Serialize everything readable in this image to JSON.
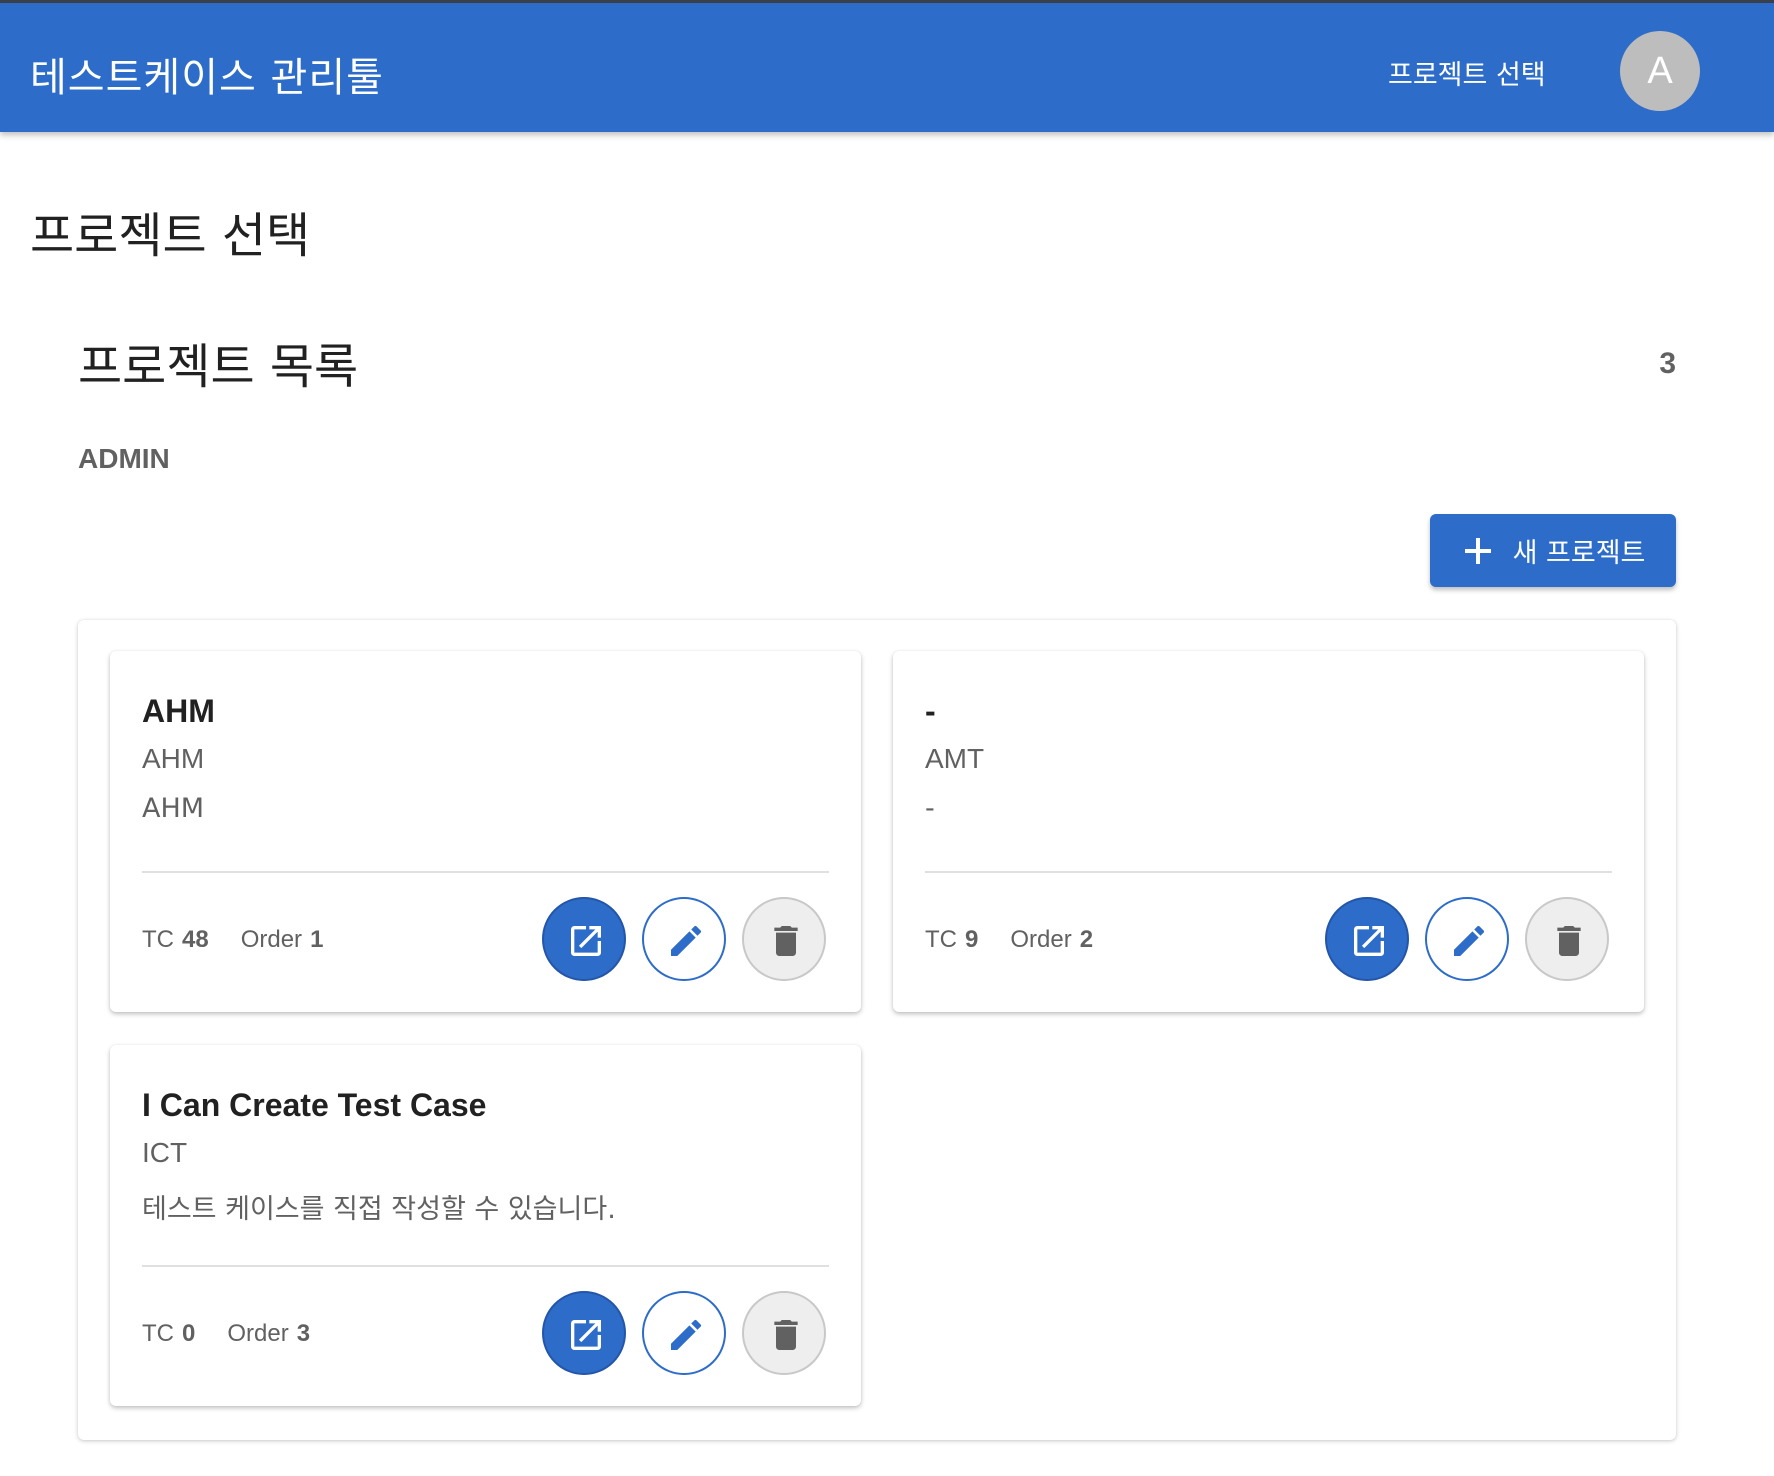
{
  "header": {
    "app_title": "테스트케이스 관리툴",
    "nav_project_select": "프로젝트 선택",
    "avatar_initial": "A"
  },
  "page": {
    "title": "프로젝트 선택"
  },
  "projects_section": {
    "title": "프로젝트 목록",
    "count": "3",
    "role": "ADMIN",
    "new_button_label": "새 프로젝트"
  },
  "projects": [
    {
      "name": "AHM",
      "key": "AHM",
      "description": "AHM",
      "tc_label": "TC",
      "tc_count": "48",
      "order_label": "Order",
      "order": "1"
    },
    {
      "name": "-",
      "key": "AMT",
      "description": "-",
      "tc_label": "TC",
      "tc_count": "9",
      "order_label": "Order",
      "order": "2"
    },
    {
      "name": "I Can Create Test Case",
      "key": "ICT",
      "description": "테스트 케이스를 직접 작성할 수 있습니다.",
      "tc_label": "TC",
      "tc_count": "0",
      "order_label": "Order",
      "order": "3"
    }
  ],
  "colors": {
    "primary": "#2d6cc8",
    "avatar_bg": "#bdbdbd",
    "delete_bg": "#eeeeee",
    "muted_text": "#616161"
  },
  "icons": {
    "open": "open-in-new-icon",
    "edit": "pencil-icon",
    "delete": "trash-icon",
    "add": "plus-icon"
  }
}
